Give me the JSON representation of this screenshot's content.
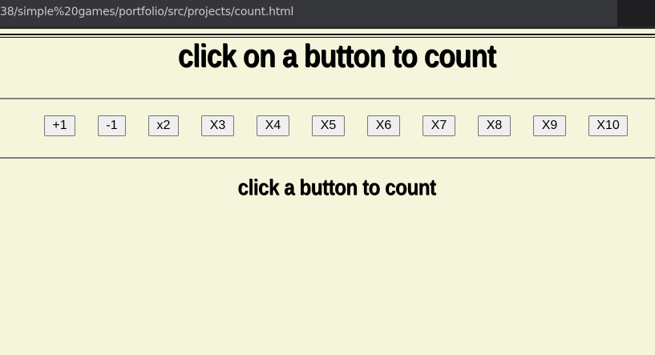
{
  "browser": {
    "url": "38/simple%20games/portfolio/src/projects/count.html"
  },
  "page": {
    "title": "click on a button to count",
    "status": "click a button to count"
  },
  "buttons": [
    {
      "label": "+1"
    },
    {
      "label": "-1"
    },
    {
      "label": "x2"
    },
    {
      "label": "X3"
    },
    {
      "label": "X4"
    },
    {
      "label": "X5"
    },
    {
      "label": "X6"
    },
    {
      "label": "X7"
    },
    {
      "label": "X8"
    },
    {
      "label": "X9"
    },
    {
      "label": "X10"
    }
  ],
  "colors": {
    "background": "#f5f5dc",
    "rule": "#808080",
    "button_bg": "#efefef",
    "button_border": "#767676"
  }
}
